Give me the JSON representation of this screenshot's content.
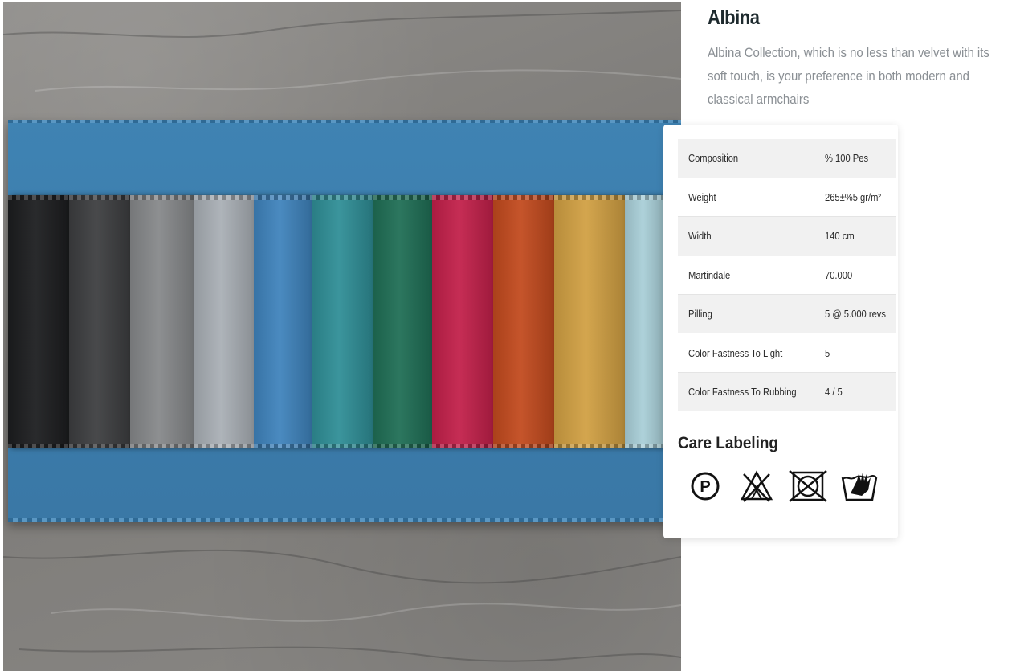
{
  "product": {
    "title": "Albina",
    "description": "Albina Collection, which is no less than velvet with its soft touch, is your preference in both modern and classical armchairs"
  },
  "image": {
    "icon": "fabric-swatch-photo",
    "band_color": "#3b7cab",
    "swatch_colors": [
      "#1c1d1f",
      "#3d3e40",
      "#86888a",
      "#a9afb5",
      "#3f83bc",
      "#2f8e96",
      "#1f6e55",
      "#c2204a",
      "#c24a1e",
      "#d1a043",
      "#a9cfd8"
    ]
  },
  "specs": [
    {
      "label": "Composition",
      "value": "% 100 Pes"
    },
    {
      "label": "Weight",
      "value": "265±%5 gr/m²"
    },
    {
      "label": "Width",
      "value": "140 cm"
    },
    {
      "label": "Martindale",
      "value": "70.000"
    },
    {
      "label": "Pilling",
      "value": "5 @ 5.000 revs"
    },
    {
      "label": "Color Fastness To Light",
      "value": "5"
    },
    {
      "label": "Color Fastness To Rubbing",
      "value": "4 / 5"
    }
  ],
  "care": {
    "title": "Care Labeling",
    "icons": [
      "dry-clean-p-icon",
      "no-bleach-icon",
      "do-not-tumble-dry-icon",
      "hand-wash-icon"
    ]
  }
}
